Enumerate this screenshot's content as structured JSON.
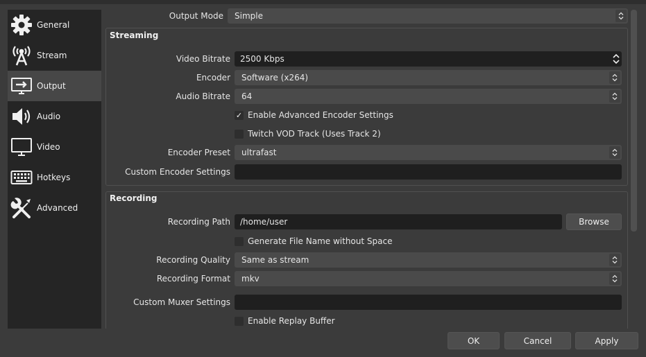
{
  "sidebar": {
    "items": [
      {
        "label": "General",
        "icon": "gear-icon"
      },
      {
        "label": "Stream",
        "icon": "antenna-icon"
      },
      {
        "label": "Output",
        "icon": "monitor-arrow-icon",
        "active": true
      },
      {
        "label": "Audio",
        "icon": "speaker-icon"
      },
      {
        "label": "Video",
        "icon": "monitor-icon"
      },
      {
        "label": "Hotkeys",
        "icon": "keyboard-icon"
      },
      {
        "label": "Advanced",
        "icon": "wrench-screwdriver-icon"
      }
    ]
  },
  "output_mode": {
    "label": "Output Mode",
    "value": "Simple"
  },
  "streaming": {
    "title": "Streaming",
    "video_bitrate": {
      "label": "Video Bitrate",
      "value": "2500 Kbps"
    },
    "encoder": {
      "label": "Encoder",
      "value": "Software (x264)"
    },
    "audio_bitrate": {
      "label": "Audio Bitrate",
      "value": "64"
    },
    "advanced_encoder": {
      "label": "Enable Advanced Encoder Settings",
      "checked": true,
      "mark": "✓"
    },
    "twitch_vod": {
      "label": "Twitch VOD Track (Uses Track 2)",
      "checked": false
    },
    "encoder_preset": {
      "label": "Encoder Preset",
      "value": "ultrafast"
    },
    "custom_encoder": {
      "label": "Custom Encoder Settings",
      "value": ""
    }
  },
  "recording": {
    "title": "Recording",
    "path": {
      "label": "Recording Path",
      "value": "/home/user",
      "browse": "Browse"
    },
    "no_space": {
      "label": "Generate File Name without Space",
      "checked": false
    },
    "quality": {
      "label": "Recording Quality",
      "value": "Same as stream"
    },
    "format": {
      "label": "Recording Format",
      "value": "mkv"
    },
    "muxer": {
      "label": "Custom Muxer Settings",
      "value": ""
    },
    "replay_buffer": {
      "label": "Enable Replay Buffer",
      "checked": false
    }
  },
  "buttons": {
    "ok": "OK",
    "cancel": "Cancel",
    "apply": "Apply"
  }
}
